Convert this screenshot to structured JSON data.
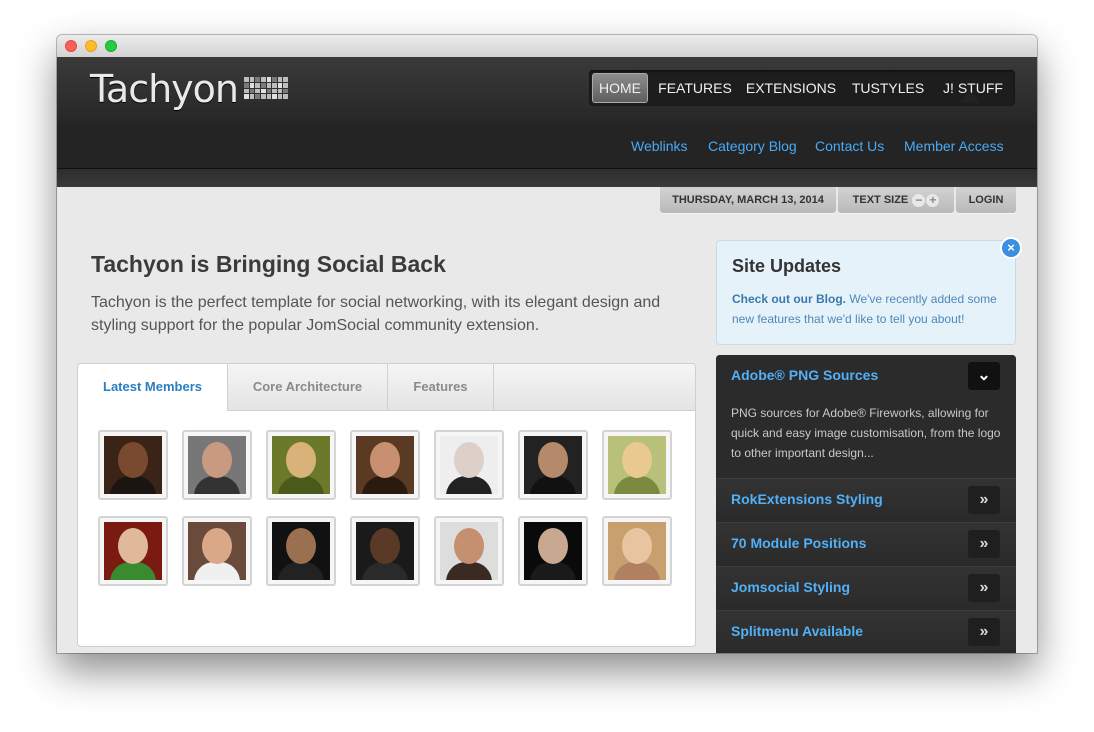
{
  "site": {
    "logo": "Tachyon"
  },
  "mainnav": {
    "items": [
      {
        "label": "HOME",
        "active": true
      },
      {
        "label": "FEATURES",
        "active": false
      },
      {
        "label": "EXTENSIONS",
        "active": false
      },
      {
        "label": "TUSTYLES",
        "active": false
      },
      {
        "label": "J! STUFF",
        "active": false
      }
    ]
  },
  "subnav": {
    "items": [
      "Weblinks",
      "Category Blog",
      "Contact Us",
      "Member Access"
    ]
  },
  "topbar": {
    "date": "THURSDAY, MARCH 13, 2014",
    "text_size": "TEXT SIZE",
    "login": "LOGIN"
  },
  "intro": {
    "headline": "Tachyon is Bringing Social Back",
    "body": "Tachyon is the perfect template for social networking, with its elegant design and styling support for the popular JomSocial community extension."
  },
  "tabs": {
    "items": [
      "Latest Members",
      "Core Architecture",
      "Features"
    ],
    "active": "Latest Members"
  },
  "members": {
    "count": 14
  },
  "site_updates": {
    "title": "Site Updates",
    "link_text": "Check out our Blog.",
    "text": " We've recently added some new features that we'd like to tell you about!"
  },
  "accordion": {
    "items": [
      {
        "label": "Adobe® PNG Sources",
        "open": true,
        "description": "PNG sources for Adobe® Fireworks, allowing for quick and easy image customisation, from the logo to other important design..."
      },
      {
        "label": "RokExtensions Styling",
        "open": false
      },
      {
        "label": "70 Module Positions",
        "open": false
      },
      {
        "label": "Jomsocial Styling",
        "open": false
      },
      {
        "label": "Splitmenu Available",
        "open": false
      }
    ]
  },
  "colors": {
    "accent_blue": "#48aaf4",
    "header_dark": "#262626",
    "tab_active_text": "#2a7fc0"
  }
}
